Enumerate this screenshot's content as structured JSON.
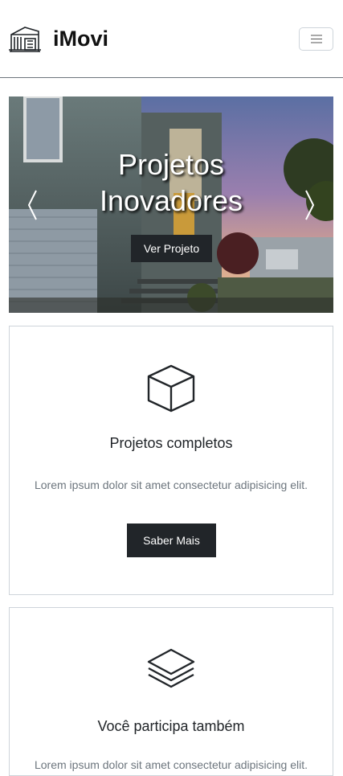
{
  "navbar": {
    "brand": "iMovi",
    "logo_icon": "building-icon",
    "toggle_icon": "hamburger-menu-icon"
  },
  "carousel": {
    "title_line1": "Projetos",
    "title_line2": "Inovadores",
    "button_label": "Ver Projeto",
    "prev_icon": "chevron-left-icon",
    "next_icon": "chevron-right-icon"
  },
  "cards": [
    {
      "icon": "box-icon",
      "title": "Projetos completos",
      "text": "Lorem ipsum dolor sit amet consectetur adipisicing elit.",
      "button_label": "Saber Mais"
    },
    {
      "icon": "layers-icon",
      "title": "Você participa também",
      "text": "Lorem ipsum dolor sit amet consectetur adipisicing elit."
    }
  ],
  "colors": {
    "dark": "#212529",
    "muted": "#6c757d",
    "border": "#ced4da"
  }
}
